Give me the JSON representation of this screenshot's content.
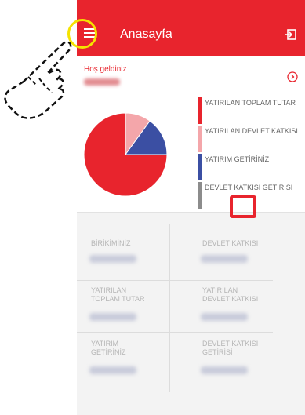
{
  "appbar": {
    "title": "Anasayfa"
  },
  "icons": {
    "menu": "hamburger-menu-icon",
    "logout": "logout-icon",
    "arrow": "chevron-right-circle-icon",
    "hand": "pointing-hand-icon"
  },
  "welcome": {
    "greeting": "Hoş geldiniz"
  },
  "legend": [
    {
      "label": "YATIRILAN TOPLAM TUTAR",
      "color": "#e8242d"
    },
    {
      "label": "YATIRILAN DEVLET KATKISI",
      "color": "#f4a6aa"
    },
    {
      "label": "YATIRIM GETİRİNİZ",
      "color": "#3b4fa3"
    },
    {
      "label": "DEVLET KATKISI GETİRİSİ",
      "color": "#8c8c8c"
    }
  ],
  "chart_data": {
    "type": "pie",
    "categories": [
      "YATIRILAN TOPLAM TUTAR",
      "YATIRILAN DEVLET KATKISI",
      "YATIRIM GETİRİNİZ",
      "DEVLET KATKISI GETİRİSİ"
    ],
    "values": [
      75,
      10,
      15,
      0
    ]
  },
  "summary": {
    "birikiminiz": "BİRİKİMİNİZ",
    "devlet_katkisi": "DEVLET KATKISI",
    "yatirilan_toplam": "YATIRILAN TOPLAM TUTAR",
    "yatirilan_devlet": "YATIRILAN DEVLET KATKISI",
    "yatirim_getiri": "YATIRIM GETİRİNİZ",
    "devlet_getiri": "DEVLET KATKISI GETİRİSİ"
  },
  "colors": {
    "brand_red": "#e8242d",
    "highlight_yellow": "#f5e300"
  }
}
